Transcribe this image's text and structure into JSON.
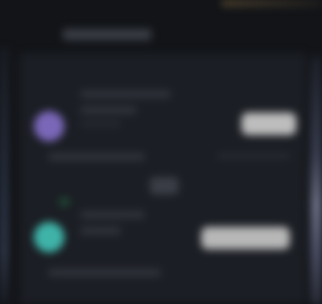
{
  "window": {
    "accent_top": "#5a4a30",
    "panel_bg": "#1b1e24",
    "background": "#121418"
  },
  "header": {
    "title": ""
  },
  "items": [
    {
      "avatar_color": "#7a67b8",
      "title": "",
      "subtitle": "",
      "action_label": "",
      "meta": ""
    },
    {
      "avatar_color": "#3fb3a8",
      "title": "",
      "subtitle": "",
      "action_label": "",
      "meta": ""
    }
  ]
}
